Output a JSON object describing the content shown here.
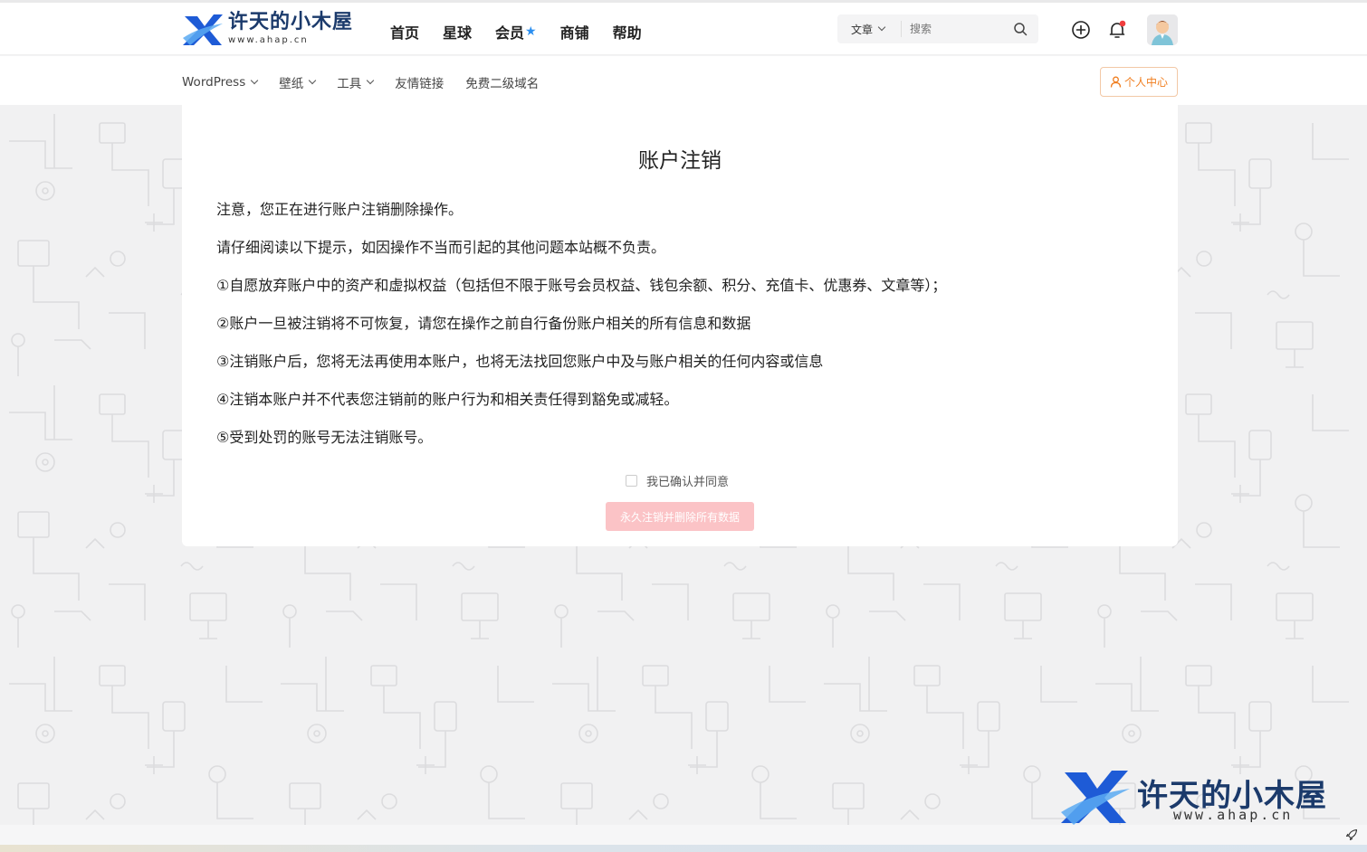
{
  "site": {
    "logo_name": "许天的小木屋",
    "logo_url": "www.ahap.cn",
    "brand_color": "#1b3a6b",
    "accent_color": "#2b8ff0"
  },
  "main_nav": [
    {
      "label": "首页"
    },
    {
      "label": "星球"
    },
    {
      "label": "会员"
    },
    {
      "label": "商铺"
    },
    {
      "label": "帮助"
    }
  ],
  "search": {
    "category": "文章",
    "placeholder": "搜索"
  },
  "sub_nav": [
    {
      "label": "WordPress",
      "dropdown": true
    },
    {
      "label": "壁纸",
      "dropdown": true
    },
    {
      "label": "工具",
      "dropdown": true
    },
    {
      "label": "友情链接",
      "dropdown": false
    },
    {
      "label": "免费二级域名",
      "dropdown": false
    }
  ],
  "user_center": {
    "label": "个人中心",
    "color": "#f07d1e"
  },
  "page": {
    "title": "账户注销",
    "paragraphs": [
      "注意，您正在进行账户注销删除操作。",
      "请仔细阅读以下提示，如因操作不当而引起的其他问题本站概不负责。",
      "①自愿放弃账户中的资产和虚拟权益（包括但不限于账号会员权益、钱包余额、积分、充值卡、优惠券、文章等）；",
      "②账户一旦被注销将不可恢复，请您在操作之前自行备份账户相关的所有信息和数据",
      "③注销账户后，您将无法再使用本账户，也将无法找回您账户中及与账户相关的任何内容或信息",
      "④注销本账户并不代表您注销前的账户行为和相关责任得到豁免或减轻。",
      "⑤受到处罚的账号无法注销账号。"
    ],
    "agree_label": "我已确认并同意",
    "agree_checked": false,
    "delete_button": "永久注销并删除所有数据",
    "delete_button_color": "#fbc3c6"
  },
  "watermark": {
    "name": "许天的小木屋",
    "url": "www.ahap.cn"
  }
}
